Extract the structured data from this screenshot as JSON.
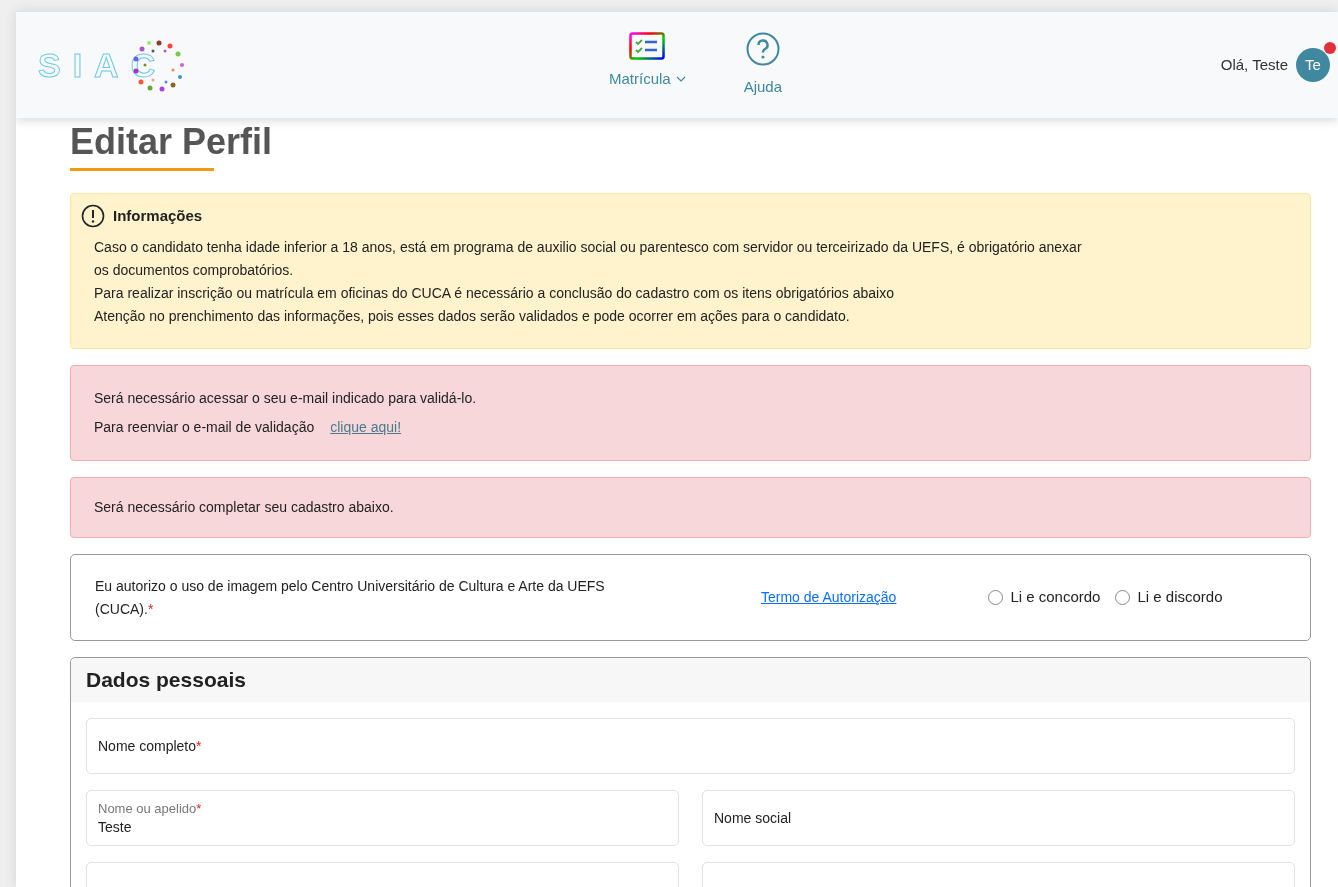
{
  "header": {
    "logo": "SIAC",
    "nav": [
      {
        "label": "Matrícula",
        "kind": "dropdown"
      },
      {
        "label": "Ajuda",
        "kind": "help"
      }
    ],
    "greeting": "Olá, Teste",
    "avatar": "Te",
    "notification": true
  },
  "page_title": "Editar Perfil",
  "info": {
    "title": "Informações",
    "lines": [
      "Caso o candidato tenha idade inferior a 18 anos, está em programa de auxilio social ou parentesco com servidor ou terceirizado da UEFS, é obrigatório anexar os documentos comprobatórios.",
      "Para realizar inscrição ou matrícula em oficinas do CUCA é necessário a conclusão do cadastro com os itens obrigatórios abaixo",
      "Atenção no prenchimento das informações, pois esses dados serão validados e pode ocorrer em ações para o candidato."
    ]
  },
  "alerts": [
    {
      "lines": [
        "Será necessário acessar o seu e-mail indicado para validá-lo.",
        "Para reenviar o e-mail de validação"
      ],
      "link": "clique aqui!"
    },
    {
      "lines": [
        "Será necessário completar seu cadastro abaixo."
      ]
    }
  ],
  "consent": {
    "text": "Eu autorizo o uso de imagem pelo Centro Universitário de Cultura e Arte da UEFS (CUCA).",
    "required_mark": "*",
    "link": "Termo de Autorização",
    "options": [
      {
        "label": "Li e concordo",
        "selected": false
      },
      {
        "label": "Li e discordo",
        "selected": false
      }
    ]
  },
  "personal": {
    "title": "Dados pessoais",
    "rows": [
      [
        {
          "kind": "labeled",
          "label": "Nome completo",
          "required_mark": "*"
        }
      ],
      [
        {
          "kind": "filled",
          "label": "Nome ou apelido",
          "required_mark": "*",
          "value": "Teste"
        },
        {
          "kind": "labeled",
          "label": "Nome social"
        }
      ],
      [
        {
          "kind": "cut"
        },
        {
          "kind": "cut"
        }
      ]
    ]
  }
}
